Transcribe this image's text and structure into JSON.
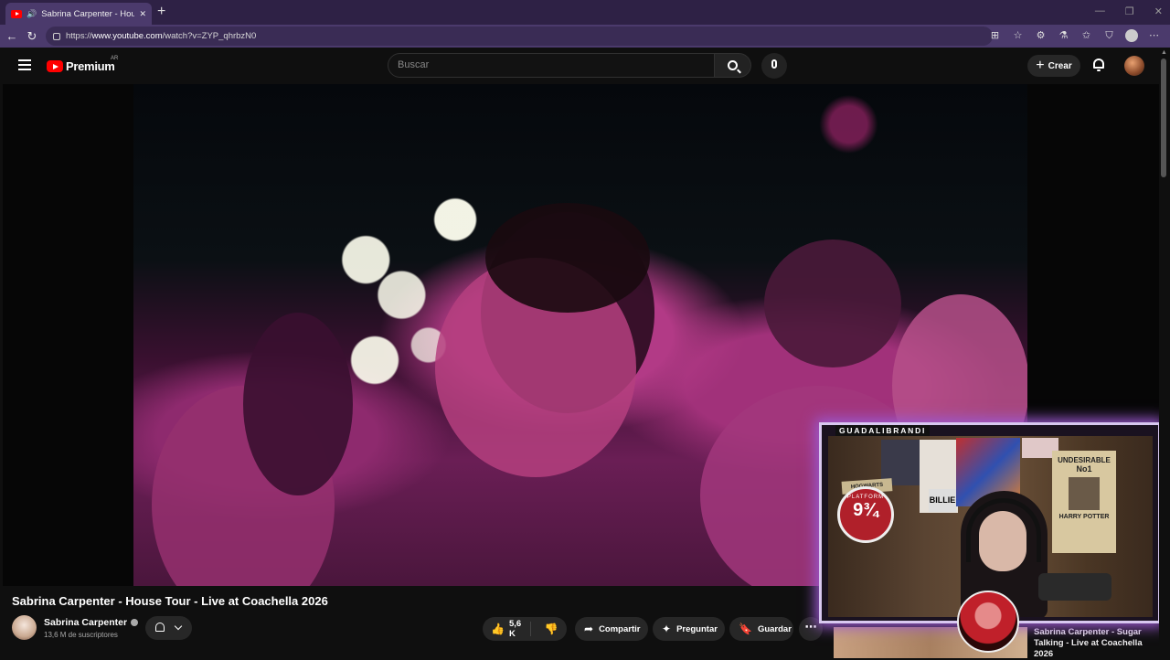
{
  "browser": {
    "tab_title": "Sabrina Carpenter - House Tour",
    "tab_close": "✕",
    "new_tab": "+",
    "url_prefix": "https://",
    "url_host": "www.youtube.com",
    "url_path": "/watch?v=ZYP_qhrbzN0",
    "window_controls": [
      "—",
      "❐",
      "✕"
    ]
  },
  "youtube": {
    "logo_text": "Premium",
    "region": "AR",
    "search_placeholder": "Buscar",
    "create_label": "Crear"
  },
  "video": {
    "title": "Sabrina Carpenter - House Tour - Live at Coachella 2026",
    "channel_name": "Sabrina Carpenter",
    "subscribers": "13,6 M de suscriptores",
    "likes": "5,6 K",
    "actions": {
      "share": "Compartir",
      "ask": "Preguntar",
      "save": "Guardar"
    }
  },
  "overlay": {
    "streamer_name": "GUADALIBRANDI",
    "poster_platform_top": "PLATFORM",
    "poster_platform_num": "9¾",
    "poster_hogwarts": "HOGWARTS EXPRESS",
    "poster_billie": "BILLIE",
    "poster_undesirable": "UNDESIRABLE",
    "poster_no1": "No1",
    "poster_hp": "HARRY POTTER"
  },
  "next_video": {
    "title": "Sabrina Carpenter - Sugar Talking - Live at Coachella 2026"
  }
}
